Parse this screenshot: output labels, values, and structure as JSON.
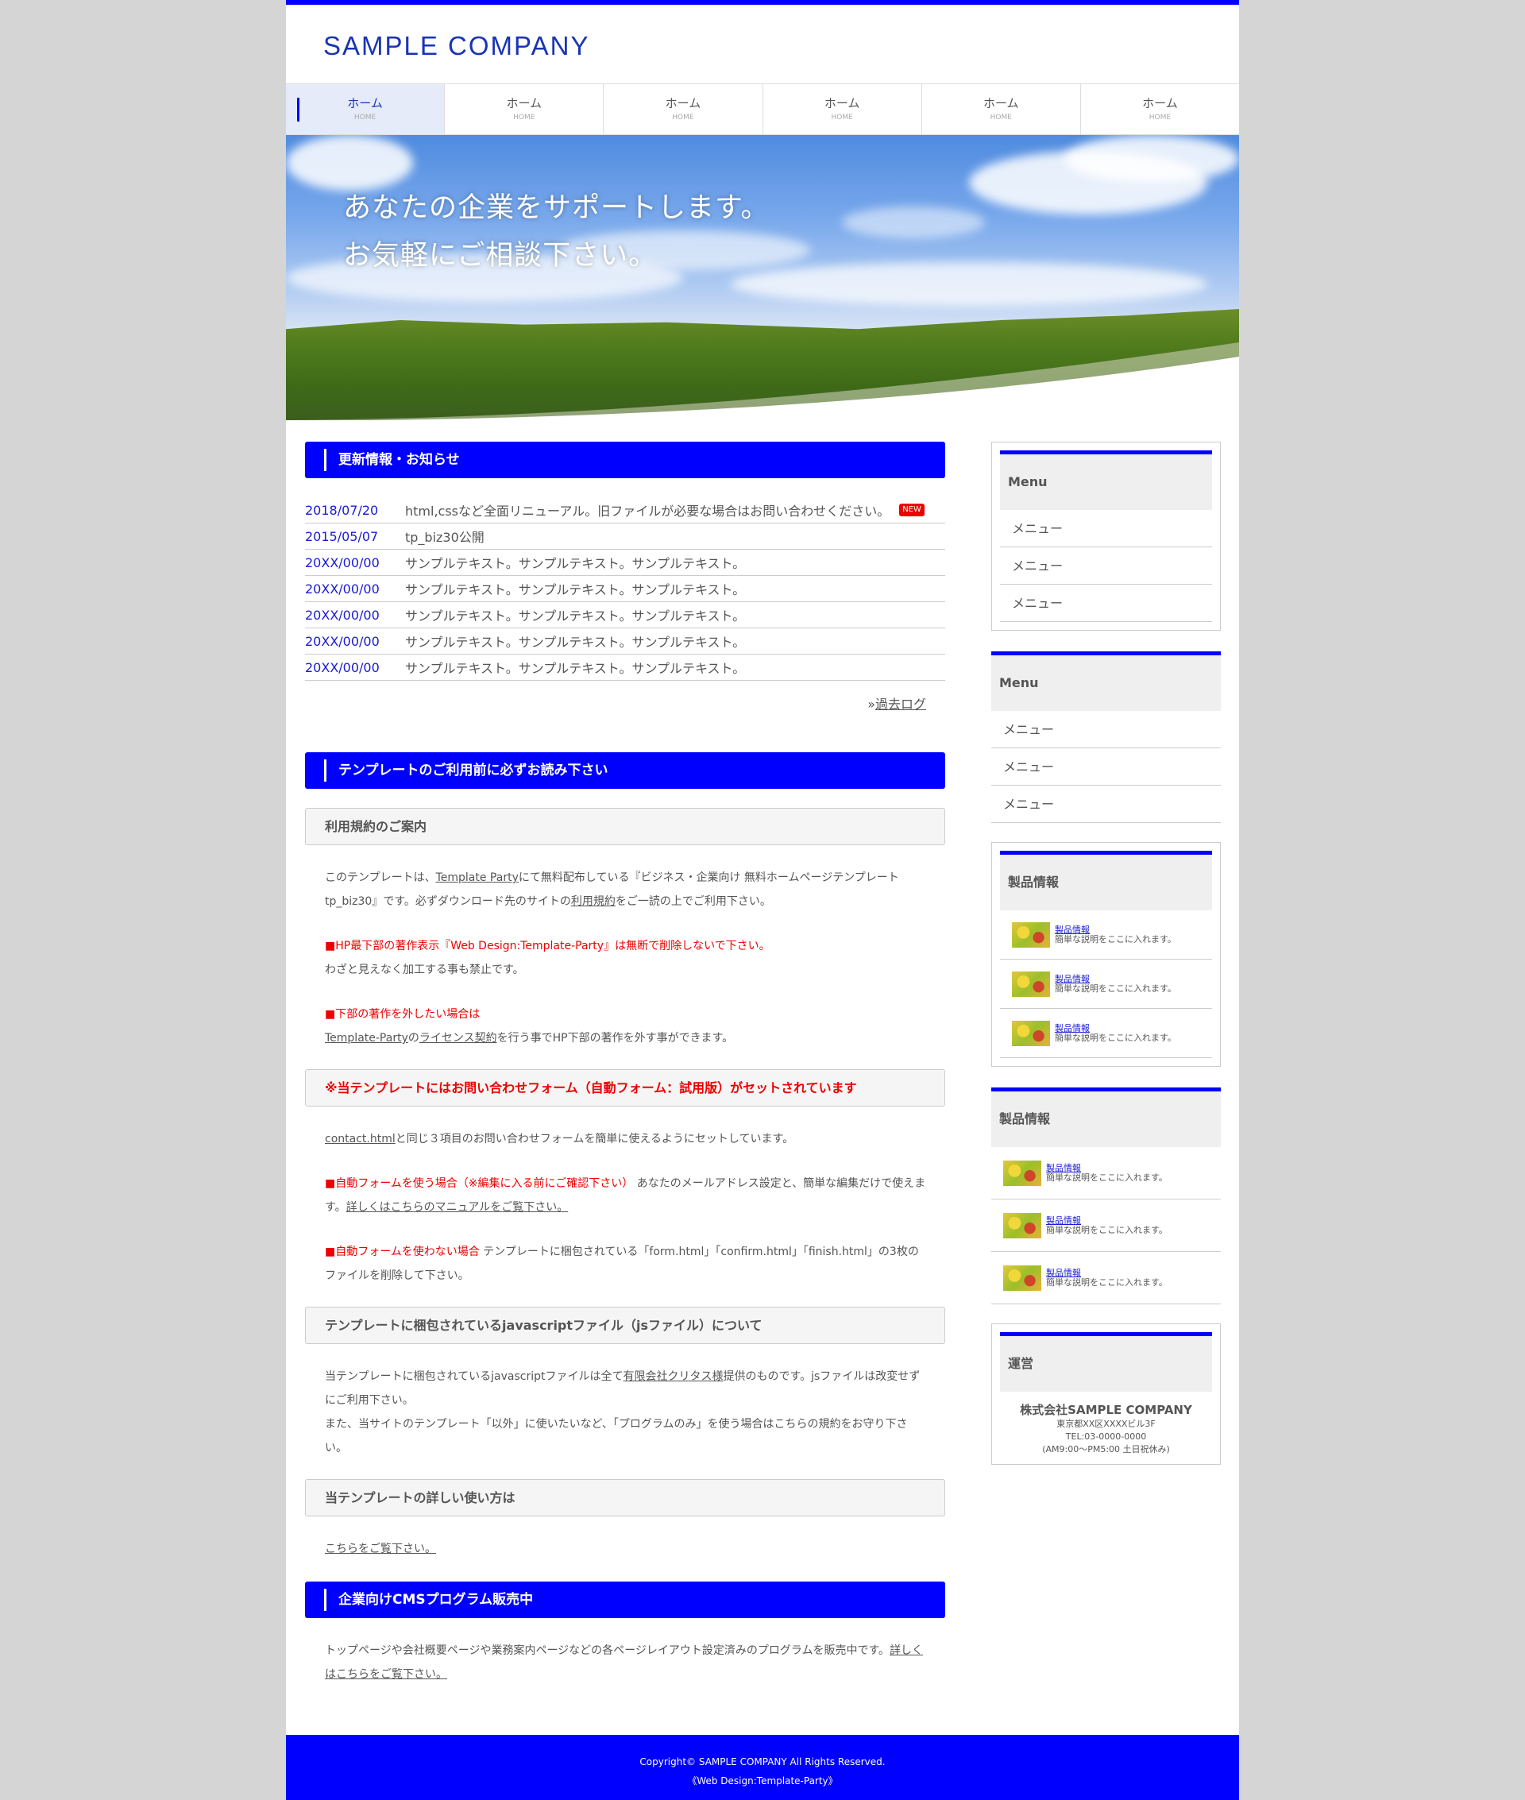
{
  "header": {
    "logo": "SAMPLE COMPANY"
  },
  "nav": [
    {
      "label": "ホーム",
      "sub": "HOME"
    },
    {
      "label": "ホーム",
      "sub": "HOME"
    },
    {
      "label": "ホーム",
      "sub": "HOME"
    },
    {
      "label": "ホーム",
      "sub": "HOME"
    },
    {
      "label": "ホーム",
      "sub": "HOME"
    },
    {
      "label": "ホーム",
      "sub": "HOME"
    }
  ],
  "hero": {
    "line1": "あなたの企業をサポートします。",
    "line2": "お気軽にご相談下さい。"
  },
  "news": {
    "title": "更新情報・お知らせ",
    "items": [
      {
        "date": "2018/07/20",
        "text": "html,cssなど全面リニューアル。旧ファイルが必要な場合はお問い合わせください。",
        "badge": "NEW"
      },
      {
        "date": "2015/05/07",
        "text": "tp_biz30公開"
      },
      {
        "date": "20XX/00/00",
        "text": "サンプルテキスト。サンプルテキスト。サンプルテキスト。"
      },
      {
        "date": "20XX/00/00",
        "text": "サンプルテキスト。サンプルテキスト。サンプルテキスト。"
      },
      {
        "date": "20XX/00/00",
        "text": "サンプルテキスト。サンプルテキスト。サンプルテキスト。"
      },
      {
        "date": "20XX/00/00",
        "text": "サンプルテキスト。サンプルテキスト。サンプルテキスト。"
      },
      {
        "date": "20XX/00/00",
        "text": "サンプルテキスト。サンプルテキスト。サンプルテキスト。"
      }
    ],
    "past_prefix": "»",
    "past_link": "過去ログ"
  },
  "template": {
    "title": "テンプレートのご利用前に必ずお読み下さい",
    "terms_heading": "利用規約のご案内",
    "p1_a": "このテンプレートは、",
    "p1_link": "Template Party",
    "p1_b": "にて無料配布している『ビジネス・企業向け 無料ホームページテンプレート tp_biz30』です。必ずダウンロード先のサイトの",
    "p1_link2": "利用規約",
    "p1_c": "をご一読の上でご利用下さい。",
    "p2_red": "■HP最下部の著作表示『Web Design:Template-Party』は無断で削除しないで下さい。",
    "p2_b": "わざと見えなく加工する事も禁止です。",
    "p3_red": "■下部の著作を外したい場合は",
    "p3_link": "Template-Party",
    "p3_b": "の",
    "p3_link2": "ライセンス契約",
    "p3_c": "を行う事でHP下部の著作を外す事ができます。",
    "form_heading": "※当テンプレートにはお問い合わせフォーム（自動フォーム：試用版）がセットされています",
    "p4_link": "contact.html",
    "p4_b": "と同じ３項目のお問い合わせフォームを簡単に使えるようにセットしています。",
    "p5_red": "■自動フォームを使う場合（※編集に入る前にご確認下さい）",
    "p5_b": " あなたのメールアドレス設定と、簡単な編集だけで使えます。",
    "p5_link": "詳しくはこちらのマニュアルをご覧下さい。",
    "p6_red": "■自動フォームを使わない場合",
    "p6_b": " テンプレートに梱包されている「form.html」「confirm.html」「finish.html」の3枚のファイルを削除して下さい。",
    "js_heading": "テンプレートに梱包されているjavascriptファイル（jsファイル）について",
    "p7_a": "当テンプレートに梱包されているjavascriptファイルは全て",
    "p7_link": "有限会社クリタス様",
    "p7_b": "提供のものです。jsファイルは改変せずにご利用下さい。",
    "p7_c": "また、当サイトのテンプレート「以外」に使いたいなど、「プログラムのみ」を使う場合はこちらの規約をお守り下さい。",
    "usage_heading": "当テンプレートの詳しい使い方は",
    "usage_link": "こちらをご覧下さい。"
  },
  "cms": {
    "title": "企業向けCMSプログラム販売中",
    "text": "トップページや会社概要ページや業務案内ページなどの各ページレイアウト設定済みのプログラムを販売中です。",
    "link": "詳しくはこちらをご覧下さい。"
  },
  "sidebar": {
    "menu1": {
      "title": "Menu",
      "items": [
        "メニュー",
        "メニュー",
        "メニュー"
      ]
    },
    "menu2": {
      "title": "Menu",
      "items": [
        "メニュー",
        "メニュー",
        "メニュー"
      ]
    },
    "products1": {
      "title": "製品情報",
      "items": [
        {
          "name": "製品情報",
          "desc": "簡単な説明をここに入れます。"
        },
        {
          "name": "製品情報",
          "desc": "簡単な説明をここに入れます。"
        },
        {
          "name": "製品情報",
          "desc": "簡単な説明をここに入れます。"
        }
      ]
    },
    "products2": {
      "title": "製品情報",
      "items": [
        {
          "name": "製品情報",
          "desc": "簡単な説明をここに入れます。"
        },
        {
          "name": "製品情報",
          "desc": "簡単な説明をここに入れます。"
        },
        {
          "name": "製品情報",
          "desc": "簡単な説明をここに入れます。"
        }
      ]
    },
    "company": {
      "title": "運営",
      "name": "株式会社SAMPLE COMPANY",
      "address": "東京都XX区XXXXビル3F",
      "tel": "TEL:03-0000-0000",
      "hours": "(AM9:00～PM5:00 土日祝休み)"
    }
  },
  "footer": {
    "copyright": "Copyright© SAMPLE COMPANY All Rights Reserved.",
    "credit": "《Web Design:Template-Party》"
  },
  "colors": {
    "accent": "#0000ff",
    "logo": "#1a34b3",
    "red": "#ee0000",
    "page_bg": "#d5d5d5"
  }
}
